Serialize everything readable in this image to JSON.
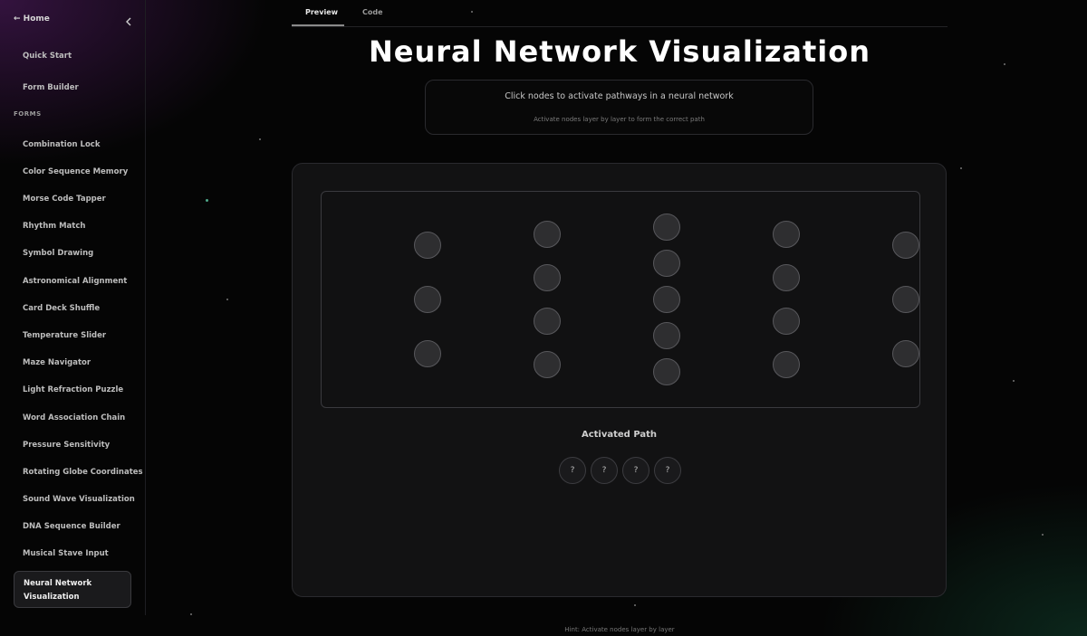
{
  "sidebar": {
    "home_label": "← Home",
    "collapse_icon": "chevron-left-icon",
    "items_top": [
      {
        "label": "Quick Start"
      },
      {
        "label": "Form Builder"
      }
    ],
    "section_label": "FORMS",
    "items": [
      {
        "label": "Combination Lock"
      },
      {
        "label": "Color Sequence Memory"
      },
      {
        "label": "Morse Code Tapper"
      },
      {
        "label": "Rhythm Match"
      },
      {
        "label": "Symbol Drawing"
      },
      {
        "label": "Astronomical Alignment"
      },
      {
        "label": "Card Deck Shuffle"
      },
      {
        "label": "Temperature Slider"
      },
      {
        "label": "Maze Navigator"
      },
      {
        "label": "Light Refraction Puzzle"
      },
      {
        "label": "Word Association Chain"
      },
      {
        "label": "Pressure Sensitivity"
      },
      {
        "label": "Rotating Globe Coordinates"
      },
      {
        "label": "Sound Wave Visualization"
      },
      {
        "label": "DNA Sequence Builder"
      },
      {
        "label": "Musical Stave Input"
      }
    ],
    "active_item": {
      "line1": "Neural Network",
      "line2": "Visualization"
    }
  },
  "tabs": [
    {
      "label": "Preview",
      "active": true
    },
    {
      "label": "Code",
      "active": false
    }
  ],
  "page": {
    "title": "Neural Network Visualization",
    "description": "Click nodes to activate pathways in a neural network",
    "subtext": "Activate nodes layer by layer to form the correct path",
    "path_title": "Activated Path",
    "path_slots": [
      "?",
      "?",
      "?",
      "?"
    ],
    "hint": "Hint: Activate nodes layer by layer"
  },
  "network": {
    "layers": [
      3,
      4,
      5,
      4,
      3
    ]
  },
  "colors": {
    "background": "#050505",
    "panel": "#121213",
    "node_fill": "#2e2e30",
    "node_border": "#58585c"
  }
}
